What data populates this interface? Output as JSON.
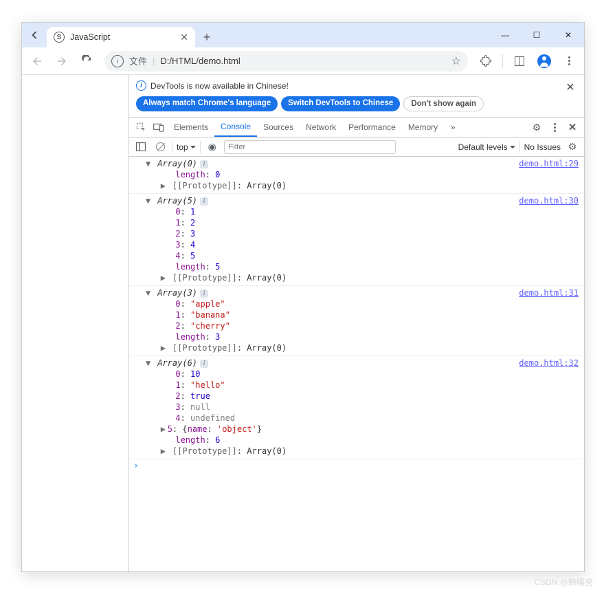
{
  "tab": {
    "title": "JavaScript"
  },
  "window_controls": {
    "minimize": "—",
    "maximize": "☐",
    "close": "✕"
  },
  "toolbar": {
    "file_label": "文件",
    "url": "D:/HTML/demo.html"
  },
  "infobar": {
    "message": "DevTools is now available in Chinese!",
    "btn_always": "Always match Chrome's language",
    "btn_switch": "Switch DevTools to Chinese",
    "btn_dont": "Don't show again"
  },
  "dt_tabs": [
    "Elements",
    "Console",
    "Sources",
    "Network",
    "Performance",
    "Memory"
  ],
  "dt_tabs_active_index": 1,
  "console_bar": {
    "context": "top",
    "filter_placeholder": "Filter",
    "levels": "Default levels",
    "issues": "No Issues"
  },
  "logs": [
    {
      "source": "demo.html:29",
      "header": {
        "label": "Array",
        "count": 0
      },
      "items": [],
      "length": 0
    },
    {
      "source": "demo.html:30",
      "header": {
        "label": "Array",
        "count": 5
      },
      "items": [
        {
          "k": "0",
          "type": "num",
          "v": "1"
        },
        {
          "k": "1",
          "type": "num",
          "v": "2"
        },
        {
          "k": "2",
          "type": "num",
          "v": "3"
        },
        {
          "k": "3",
          "type": "num",
          "v": "4"
        },
        {
          "k": "4",
          "type": "num",
          "v": "5"
        }
      ],
      "length": 5
    },
    {
      "source": "demo.html:31",
      "header": {
        "label": "Array",
        "count": 3
      },
      "items": [
        {
          "k": "0",
          "type": "str",
          "v": "\"apple\""
        },
        {
          "k": "1",
          "type": "str",
          "v": "\"banana\""
        },
        {
          "k": "2",
          "type": "str",
          "v": "\"cherry\""
        }
      ],
      "length": 3
    },
    {
      "source": "demo.html:32",
      "header": {
        "label": "Array",
        "count": 6
      },
      "items": [
        {
          "k": "0",
          "type": "num",
          "v": "10"
        },
        {
          "k": "1",
          "type": "str",
          "v": "\"hello\""
        },
        {
          "k": "2",
          "type": "num",
          "v": "true"
        },
        {
          "k": "3",
          "type": "null",
          "v": "null"
        },
        {
          "k": "4",
          "type": "null",
          "v": "undefined"
        },
        {
          "k": "5",
          "type": "obj",
          "v": "{name: 'object'}",
          "expandable": true
        }
      ],
      "length": 6
    }
  ],
  "proto_label": "[[Prototype]]",
  "proto_value": "Array(0)",
  "watermark": "CSDN @韩曙亮"
}
